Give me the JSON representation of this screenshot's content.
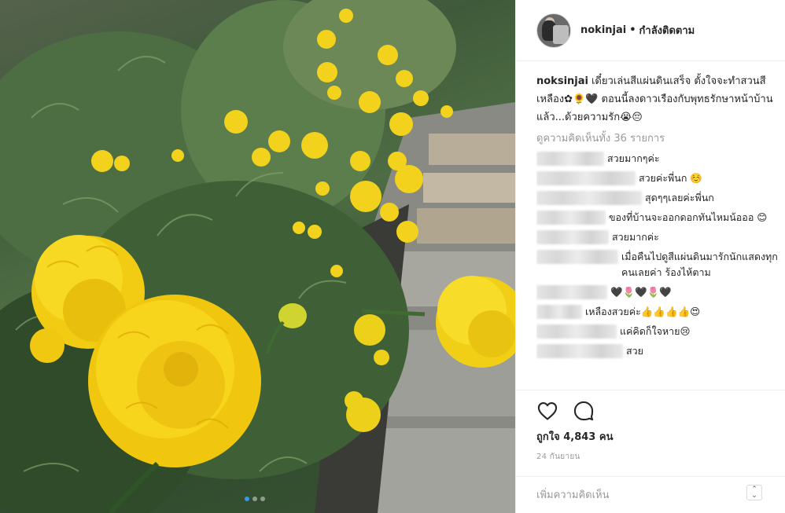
{
  "post": {
    "username": "nokinjai",
    "separator": "•",
    "follow_status": "กำลังติดตาม"
  },
  "caption": {
    "username": "noksinjai",
    "text": "เดี๋ยวเล่นสีแผ่นดินเสร็จ ตั้งใจจะทำสวนสีเหลือง✿🌻🖤 ตอนนี้ลงดาวเรืองกับพุทธรักษาหน้าบ้านแล้ว...ด้วยความรัก😭😔"
  },
  "view_all_comments": "ดูความคิดเห็นทั้ง 36 รายการ",
  "comments": [
    {
      "text": "สวยมากๆค่ะ"
    },
    {
      "text": "สวยค่ะพี่นก ☺️"
    },
    {
      "text": "สุดๆๆเลยค่ะพี่นก"
    },
    {
      "text": "ของที่บ้านจะออกดอกทันไหมน้อออ 😊"
    },
    {
      "text": "สวยมากค่ะ"
    },
    {
      "text": "เมื่อคืนไปดูสีแผ่นดินมารักนักแสดงทุกคนเลยค่า ร้องไห้ตาม"
    },
    {
      "text": "🖤🌷🖤🌷🖤"
    },
    {
      "text": "เหลืองสวยค่ะ👍👍👍👍😍"
    },
    {
      "text": "แค่คิดก็ใจหาย😢"
    },
    {
      "text": "สวย"
    }
  ],
  "likes_text": "ถูกใจ 4,843 คน",
  "date": "24 กันยายน",
  "add_comment": {
    "placeholder": "เพิ่มความคิดเห็น"
  },
  "icons": {
    "like": "heart-icon",
    "comment": "comment-bubble-icon",
    "more": "chevron-updown-icon"
  },
  "carousel": {
    "total": 3,
    "active_index": 0
  }
}
